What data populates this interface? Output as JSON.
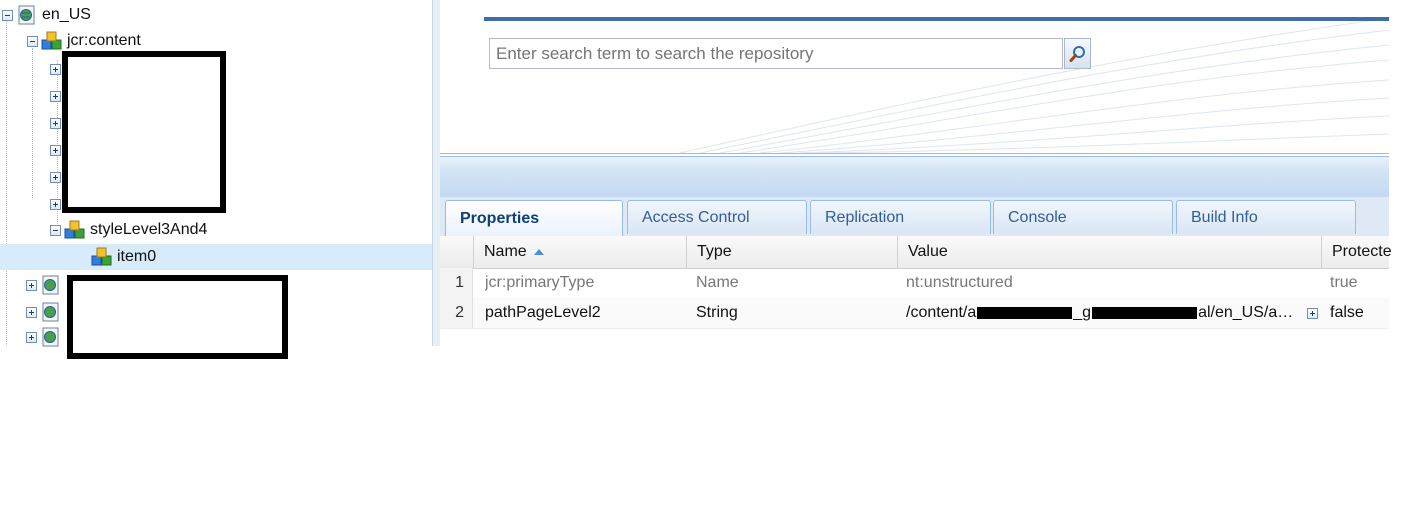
{
  "tree": {
    "nodes": [
      {
        "label": "en_US",
        "level": 0,
        "expanded": true,
        "icon": "page-icon"
      },
      {
        "label": "jcr:content",
        "level": 1,
        "expanded": true,
        "icon": "node-cubes-icon"
      },
      {
        "label": "styleLevel3And4",
        "level": 2,
        "expanded": true,
        "icon": "node-cubes-icon"
      },
      {
        "label": "item0",
        "level": 3,
        "selected": true,
        "icon": "node-cubes-icon"
      }
    ]
  },
  "search": {
    "placeholder": "Enter search term to search the repository",
    "button_icon": "search-icon"
  },
  "tabs": [
    {
      "label": "Properties",
      "active": true
    },
    {
      "label": "Access Control",
      "active": false
    },
    {
      "label": "Replication",
      "active": false
    },
    {
      "label": "Console",
      "active": false
    },
    {
      "label": "Build Info",
      "active": false
    }
  ],
  "grid": {
    "columns": [
      "Name",
      "Type",
      "Value",
      "Protecte"
    ],
    "sort_icon": "sort-ascending-icon",
    "rows": [
      {
        "num": "1",
        "name": "jcr:primaryType",
        "type": "Name",
        "value": "nt:unstructured",
        "protected": "true"
      },
      {
        "num": "2",
        "name": "pathPageLevel2",
        "type": "String",
        "value_start": "/content/a",
        "value_mid": "_g",
        "value_end": "al/en_US/a…",
        "protected": "false"
      }
    ]
  },
  "colors": {
    "accent": "#3d6ea7",
    "selection": "#d8ebfa",
    "tab_text": "#2f5f95"
  }
}
